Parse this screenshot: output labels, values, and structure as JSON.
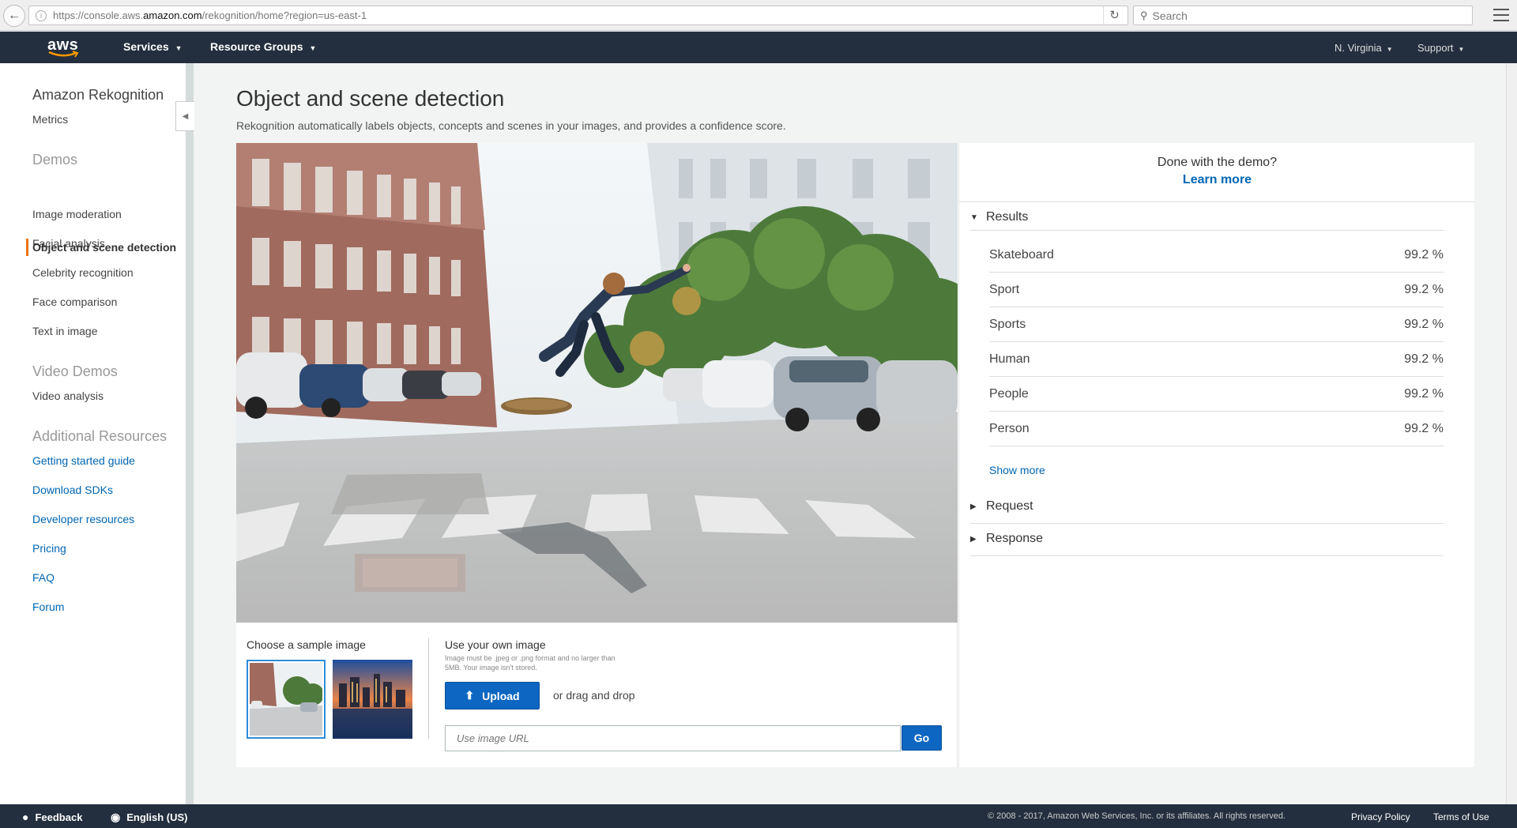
{
  "browser": {
    "url_prefix": "https://console.aws.",
    "url_host": "amazon.com",
    "url_path": "/rekognition/home?region=us-east-1",
    "search_placeholder": "Search"
  },
  "navbar": {
    "logo_text": "aws",
    "services": "Services",
    "resource_groups": "Resource Groups",
    "region": "N. Virginia",
    "support": "Support"
  },
  "sidebar": {
    "title": "Amazon Rekognition",
    "metrics": "Metrics",
    "demos_heading": "Demos",
    "demos": [
      "Object and scene detection",
      "Image moderation",
      "Facial analysis",
      "Celebrity recognition",
      "Face comparison",
      "Text in image"
    ],
    "video_heading": "Video Demos",
    "video_items": [
      "Video analysis"
    ],
    "resources_heading": "Additional Resources",
    "resources": [
      "Getting started guide",
      "Download SDKs",
      "Developer resources",
      "Pricing",
      "FAQ",
      "Forum"
    ]
  },
  "main": {
    "title": "Object and scene detection",
    "description": "Rekognition automatically labels objects, concepts and scenes in your images, and provides a confidence score."
  },
  "controls": {
    "choose_label": "Choose a sample image",
    "own_label": "Use your own image",
    "own_hint": "Image must be .jpeg or .png format and no larger than 5MB. Your image isn't stored.",
    "upload_label": "Upload",
    "drag_text": "or drag and drop",
    "url_placeholder": "Use image URL",
    "go_label": "Go"
  },
  "results": {
    "done_text": "Done with the demo?",
    "learn_more": "Learn more",
    "results_heading": "Results",
    "labels": [
      {
        "name": "Skateboard",
        "confidence": "99.2 %"
      },
      {
        "name": "Sport",
        "confidence": "99.2 %"
      },
      {
        "name": "Sports",
        "confidence": "99.2 %"
      },
      {
        "name": "Human",
        "confidence": "99.2 %"
      },
      {
        "name": "People",
        "confidence": "99.2 %"
      },
      {
        "name": "Person",
        "confidence": "99.2 %"
      }
    ],
    "show_more": "Show more",
    "request_heading": "Request",
    "response_heading": "Response"
  },
  "footer": {
    "feedback": "Feedback",
    "language": "English (US)",
    "copyright": "© 2008 - 2017, Amazon Web Services, Inc. or its affiliates. All rights reserved.",
    "privacy": "Privacy Policy",
    "terms": "Terms of Use"
  },
  "colors": {
    "navbar_bg": "#232f3e",
    "accent_orange": "#ec7211",
    "link_blue": "#0066b3",
    "button_blue": "#0d66c2"
  }
}
